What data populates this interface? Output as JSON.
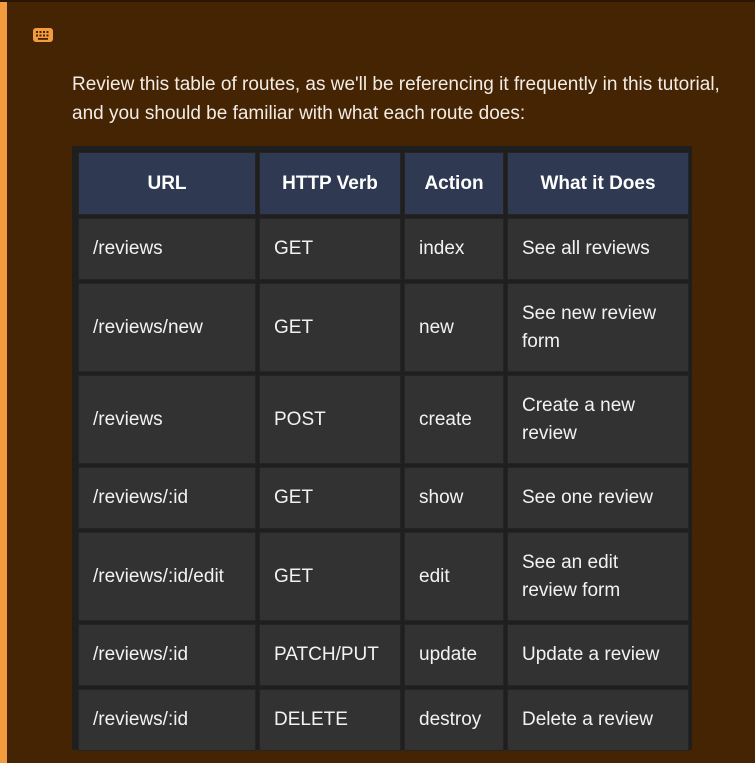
{
  "intro_text": "Review this table of routes, as we'll be referencing it frequently in this tutorial, and you should be familiar with what each route does:",
  "icon": "keyboard-icon",
  "colors": {
    "background": "#452404",
    "accent": "#f29b3f",
    "header_cell": "#2f3a52",
    "body_cell": "#323232"
  },
  "table": {
    "headers": [
      "URL",
      "HTTP Verb",
      "Action",
      "What it Does"
    ],
    "rows": [
      {
        "url": "/reviews",
        "verb": "GET",
        "action": "index",
        "does": "See all reviews"
      },
      {
        "url": "/reviews/new",
        "verb": "GET",
        "action": "new",
        "does": "See new review form"
      },
      {
        "url": "/reviews",
        "verb": "POST",
        "action": "create",
        "does": "Create a new review"
      },
      {
        "url": "/reviews/:id",
        "verb": "GET",
        "action": "show",
        "does": "See one review"
      },
      {
        "url": "/reviews/:id/edit",
        "verb": "GET",
        "action": "edit",
        "does": "See an edit review form"
      },
      {
        "url": "/reviews/:id",
        "verb": "PATCH/PUT",
        "action": "update",
        "does": "Update a review"
      },
      {
        "url": "/reviews/:id",
        "verb": "DELETE",
        "action": "destroy",
        "does": "Delete a review"
      }
    ]
  }
}
